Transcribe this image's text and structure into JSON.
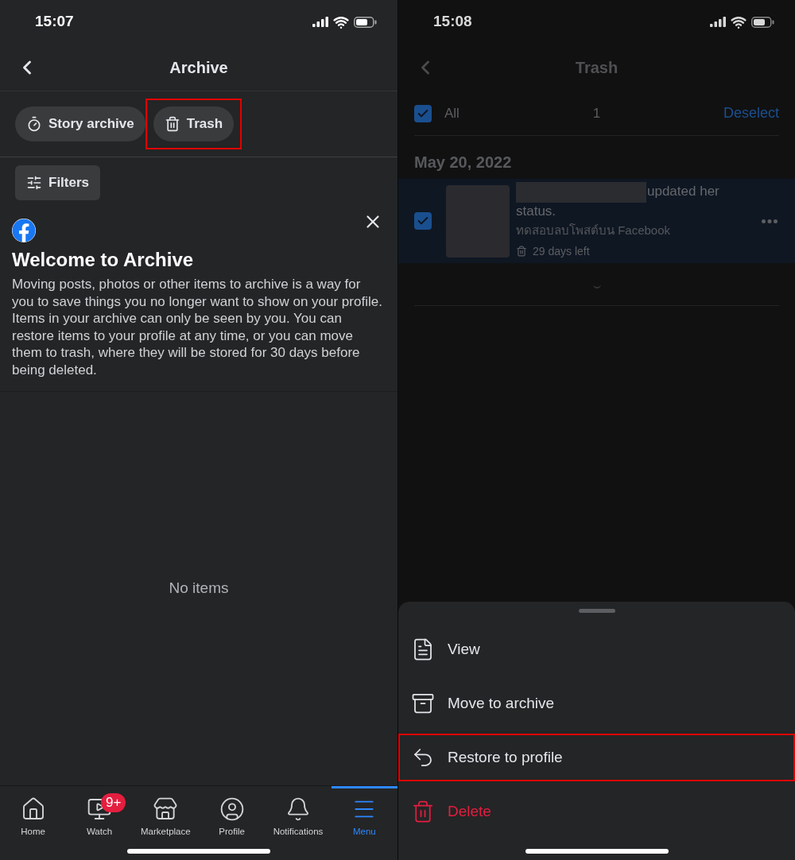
{
  "left": {
    "status_bar": {
      "time": "15:07"
    },
    "header": {
      "title": "Archive"
    },
    "tabs": [
      {
        "kind": "story",
        "label": "Story archive",
        "highlighted": false
      },
      {
        "kind": "trash",
        "label": "Trash",
        "highlighted": true
      }
    ],
    "filters_button": "Filters",
    "welcome": {
      "title": "Welcome to Archive",
      "body": "Moving posts, photos or other items to archive is a way for you to save things you no longer want to show on your profile. Items in your archive can only be seen by you. You can restore items to your profile at any time, or you can move them to trash, where they will be stored for 30 days before being deleted."
    },
    "empty_text": "No items",
    "nav": [
      {
        "kind": "home",
        "label": "Home",
        "selected": false
      },
      {
        "kind": "watch",
        "label": "Watch",
        "selected": false,
        "badge": "9+"
      },
      {
        "kind": "marketplace",
        "label": "Marketplace",
        "selected": false
      },
      {
        "kind": "profile",
        "label": "Profile",
        "selected": false
      },
      {
        "kind": "notifications",
        "label": "Notifications",
        "selected": false
      },
      {
        "kind": "menu",
        "label": "Menu",
        "selected": true
      }
    ]
  },
  "right": {
    "status_bar": {
      "time": "15:08"
    },
    "header": {
      "title": "Trash"
    },
    "select_bar": {
      "label": "All",
      "checked": true,
      "count": "1",
      "action": "Deselect"
    },
    "groups": [
      {
        "date": "May 20, 2022",
        "items": [
          {
            "title": "updated her status.",
            "subtitle": "ทดสอบลบโพสต์บน Facebook",
            "expiry": "29 days left",
            "checked": true
          }
        ]
      }
    ],
    "sheet": [
      {
        "kind": "view",
        "label": "View",
        "highlighted": false
      },
      {
        "kind": "archive",
        "label": "Move to archive",
        "highlighted": false
      },
      {
        "kind": "restore",
        "label": "Restore to profile",
        "highlighted": true
      },
      {
        "kind": "delete",
        "label": "Delete",
        "highlighted": false
      }
    ]
  }
}
